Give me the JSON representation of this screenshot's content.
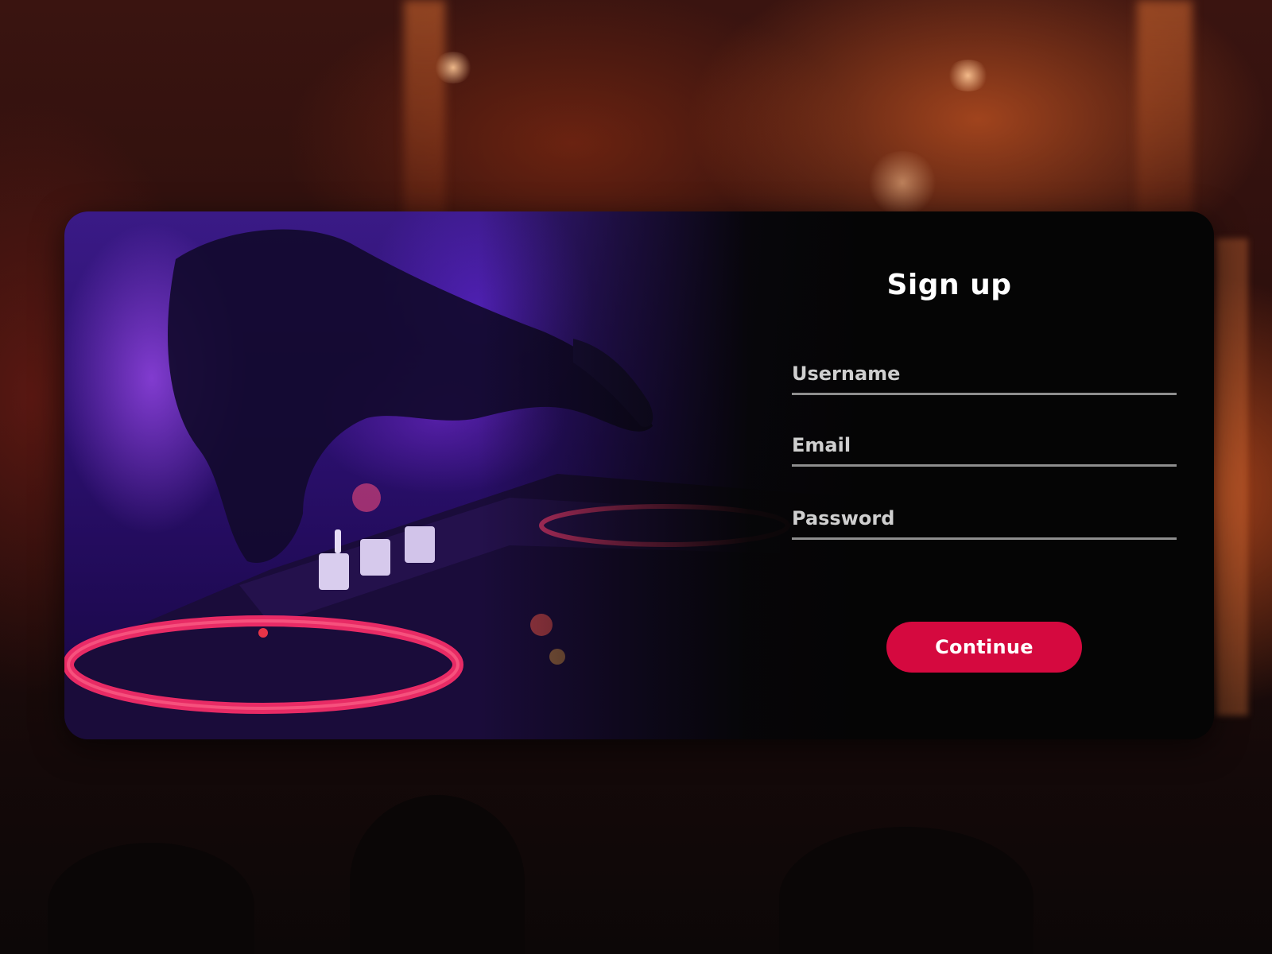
{
  "form": {
    "title": "Sign up",
    "username_placeholder": "Username",
    "email_placeholder": "Email",
    "password_placeholder": "Password",
    "submit_label": "Continue"
  },
  "theme": {
    "accent": "#d5093f",
    "card_background": "#050505",
    "underline": "#8e8e8e"
  }
}
